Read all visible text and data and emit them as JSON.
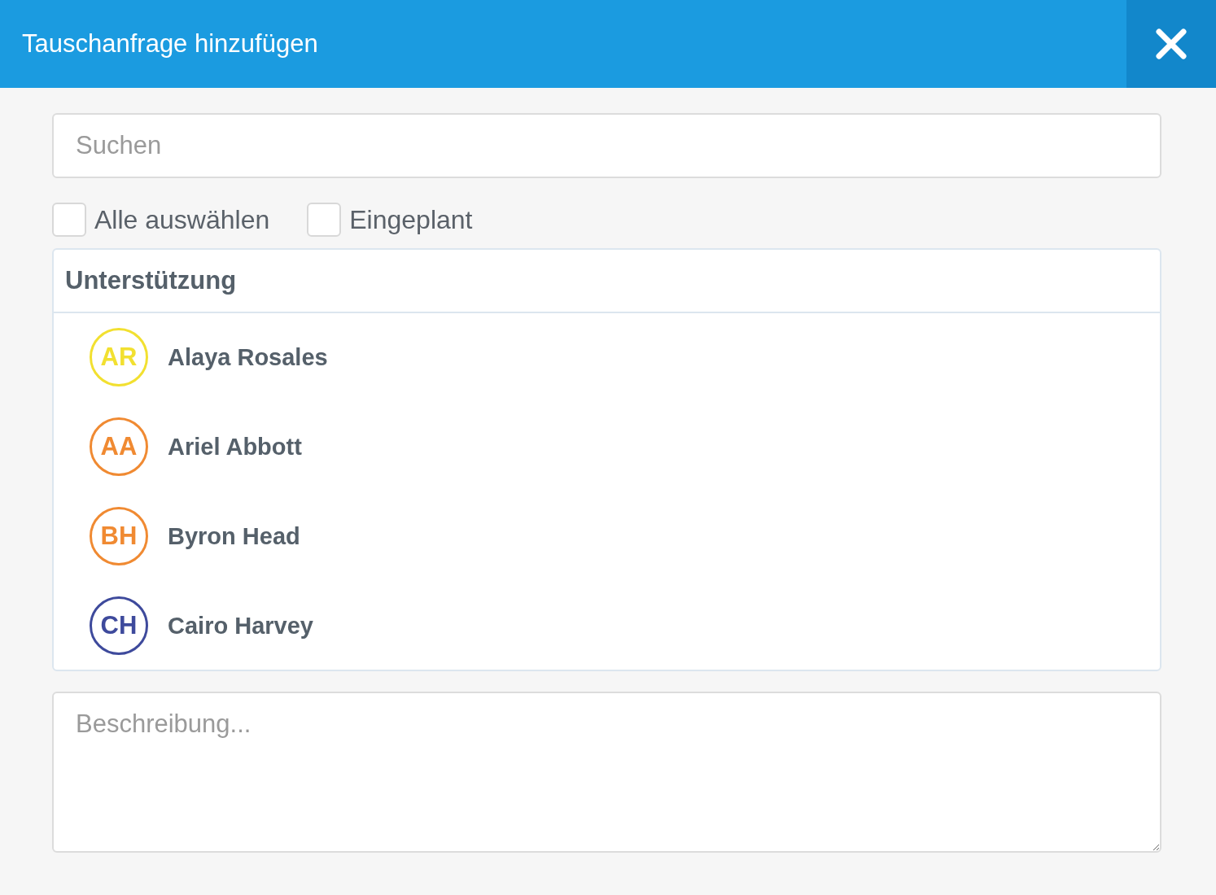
{
  "dialog": {
    "title": "Tauschanfrage hinzufügen"
  },
  "search": {
    "placeholder": "Suchen"
  },
  "filters": [
    {
      "label": "Alle auswählen",
      "checked": false
    },
    {
      "label": "Eingeplant",
      "checked": false
    }
  ],
  "group": {
    "title": "Unterstützung",
    "members": [
      {
        "initials": "AR",
        "name": "Alaya Rosales",
        "color": "#f2e030"
      },
      {
        "initials": "AA",
        "name": "Ariel Abbott",
        "color": "#f08a32"
      },
      {
        "initials": "BH",
        "name": "Byron Head",
        "color": "#f08a32"
      },
      {
        "initials": "CH",
        "name": "Cairo Harvey",
        "color": "#3e4a9c"
      }
    ]
  },
  "description": {
    "placeholder": "Beschreibung..."
  }
}
